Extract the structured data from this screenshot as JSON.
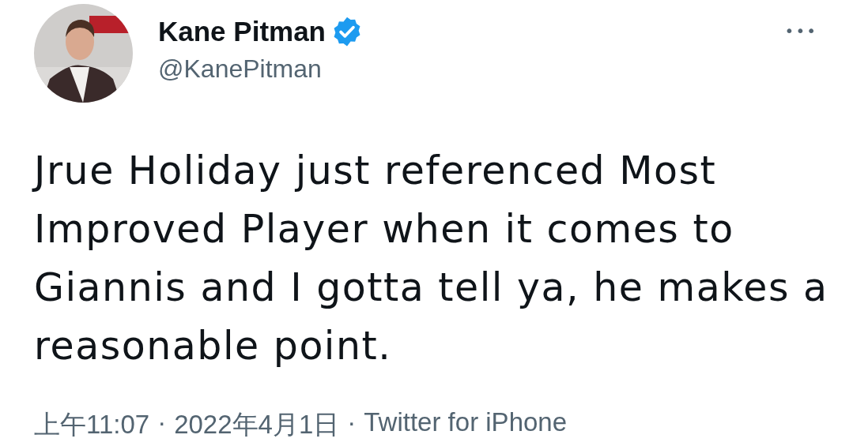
{
  "author": {
    "name": "Kane Pitman",
    "verified": true,
    "handle": "@KanePitman"
  },
  "more_menu": "•••",
  "tweet_text": "Jrue Holiday just referenced Most Improved Player when it comes to Giannis and I gotta tell ya, he makes a reasonable point.",
  "meta": [
    {
      "kind": "time",
      "text": "上午11:07"
    },
    {
      "kind": "separator",
      "text": "·"
    },
    {
      "kind": "date",
      "text": "2022年4月1日"
    },
    {
      "kind": "separator",
      "text": "·"
    },
    {
      "kind": "source",
      "text": "Twitter for iPhone"
    }
  ]
}
